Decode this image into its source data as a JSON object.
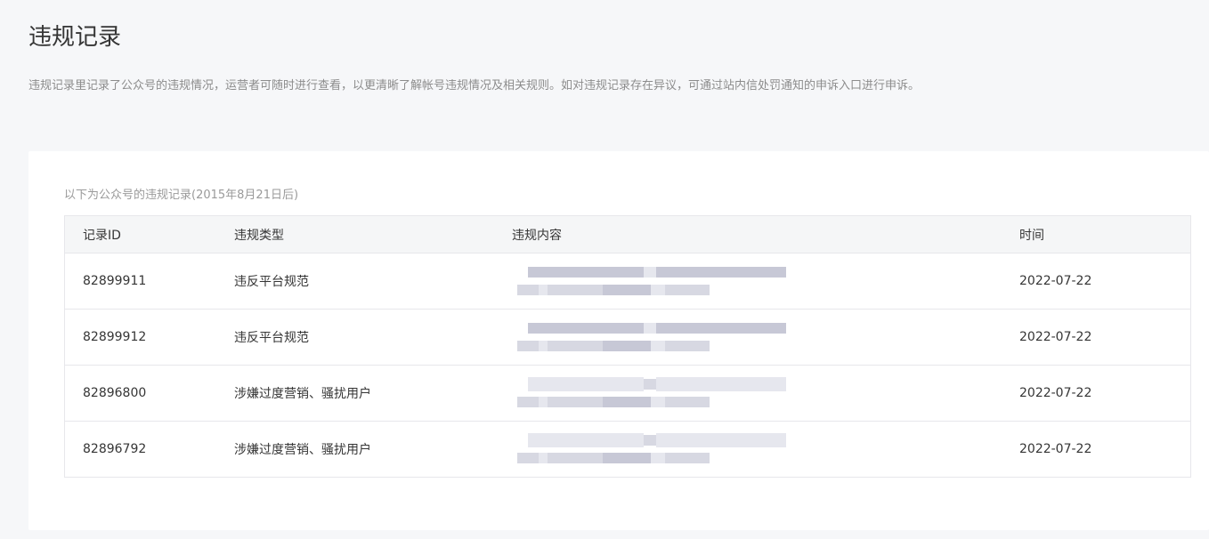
{
  "page": {
    "title": "违规记录",
    "description": "违规记录里记录了公众号的违规情况，运营者可随时进行查看，以更清晰了解帐号违规情况及相关规则。如对违规记录存在异议，可通过站内信处罚通知的申诉入口进行申诉。"
  },
  "records": {
    "caption": "以下为公众号的违规记录(2015年8月21日后)",
    "columns": {
      "id": "记录ID",
      "type": "违规类型",
      "content": "违规内容",
      "time": "时间"
    },
    "rows": [
      {
        "id": "82899911",
        "type": "违反平台规范",
        "time": "2022-07-22"
      },
      {
        "id": "82899912",
        "type": "违反平台规范",
        "time": "2022-07-22"
      },
      {
        "id": "82896800",
        "type": "涉嫌过度营销、骚扰用户",
        "time": "2022-07-22"
      },
      {
        "id": "82896792",
        "type": "涉嫌过度营销、骚扰用户",
        "time": "2022-07-22"
      }
    ]
  },
  "colors": {
    "page_background": "#f6f7f9",
    "card_background": "#ffffff",
    "link": "#576b95",
    "muted_text": "#8c8c8c",
    "header_background": "#f5f6f7"
  }
}
